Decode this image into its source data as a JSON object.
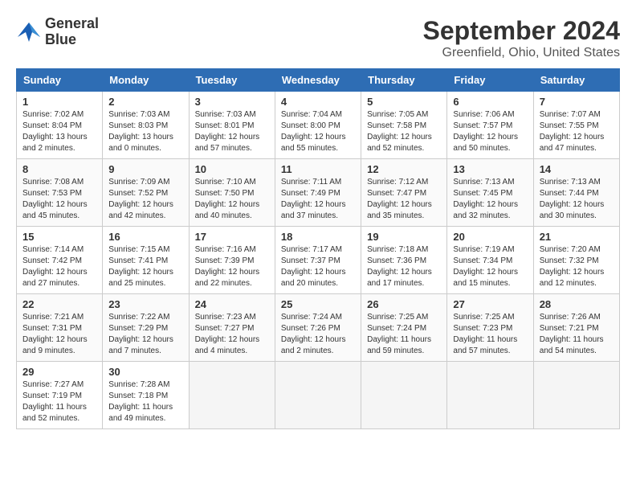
{
  "logo": {
    "line1": "General",
    "line2": "Blue"
  },
  "title": "September 2024",
  "subtitle": "Greenfield, Ohio, United States",
  "weekdays": [
    "Sunday",
    "Monday",
    "Tuesday",
    "Wednesday",
    "Thursday",
    "Friday",
    "Saturday"
  ],
  "weeks": [
    [
      {
        "day": "1",
        "sunrise": "7:02 AM",
        "sunset": "8:04 PM",
        "daylight": "13 hours and 2 minutes."
      },
      {
        "day": "2",
        "sunrise": "7:03 AM",
        "sunset": "8:03 PM",
        "daylight": "13 hours and 0 minutes."
      },
      {
        "day": "3",
        "sunrise": "7:03 AM",
        "sunset": "8:01 PM",
        "daylight": "12 hours and 57 minutes."
      },
      {
        "day": "4",
        "sunrise": "7:04 AM",
        "sunset": "8:00 PM",
        "daylight": "12 hours and 55 minutes."
      },
      {
        "day": "5",
        "sunrise": "7:05 AM",
        "sunset": "7:58 PM",
        "daylight": "12 hours and 52 minutes."
      },
      {
        "day": "6",
        "sunrise": "7:06 AM",
        "sunset": "7:57 PM",
        "daylight": "12 hours and 50 minutes."
      },
      {
        "day": "7",
        "sunrise": "7:07 AM",
        "sunset": "7:55 PM",
        "daylight": "12 hours and 47 minutes."
      }
    ],
    [
      {
        "day": "8",
        "sunrise": "7:08 AM",
        "sunset": "7:53 PM",
        "daylight": "12 hours and 45 minutes."
      },
      {
        "day": "9",
        "sunrise": "7:09 AM",
        "sunset": "7:52 PM",
        "daylight": "12 hours and 42 minutes."
      },
      {
        "day": "10",
        "sunrise": "7:10 AM",
        "sunset": "7:50 PM",
        "daylight": "12 hours and 40 minutes."
      },
      {
        "day": "11",
        "sunrise": "7:11 AM",
        "sunset": "7:49 PM",
        "daylight": "12 hours and 37 minutes."
      },
      {
        "day": "12",
        "sunrise": "7:12 AM",
        "sunset": "7:47 PM",
        "daylight": "12 hours and 35 minutes."
      },
      {
        "day": "13",
        "sunrise": "7:13 AM",
        "sunset": "7:45 PM",
        "daylight": "12 hours and 32 minutes."
      },
      {
        "day": "14",
        "sunrise": "7:13 AM",
        "sunset": "7:44 PM",
        "daylight": "12 hours and 30 minutes."
      }
    ],
    [
      {
        "day": "15",
        "sunrise": "7:14 AM",
        "sunset": "7:42 PM",
        "daylight": "12 hours and 27 minutes."
      },
      {
        "day": "16",
        "sunrise": "7:15 AM",
        "sunset": "7:41 PM",
        "daylight": "12 hours and 25 minutes."
      },
      {
        "day": "17",
        "sunrise": "7:16 AM",
        "sunset": "7:39 PM",
        "daylight": "12 hours and 22 minutes."
      },
      {
        "day": "18",
        "sunrise": "7:17 AM",
        "sunset": "7:37 PM",
        "daylight": "12 hours and 20 minutes."
      },
      {
        "day": "19",
        "sunrise": "7:18 AM",
        "sunset": "7:36 PM",
        "daylight": "12 hours and 17 minutes."
      },
      {
        "day": "20",
        "sunrise": "7:19 AM",
        "sunset": "7:34 PM",
        "daylight": "12 hours and 15 minutes."
      },
      {
        "day": "21",
        "sunrise": "7:20 AM",
        "sunset": "7:32 PM",
        "daylight": "12 hours and 12 minutes."
      }
    ],
    [
      {
        "day": "22",
        "sunrise": "7:21 AM",
        "sunset": "7:31 PM",
        "daylight": "12 hours and 9 minutes."
      },
      {
        "day": "23",
        "sunrise": "7:22 AM",
        "sunset": "7:29 PM",
        "daylight": "12 hours and 7 minutes."
      },
      {
        "day": "24",
        "sunrise": "7:23 AM",
        "sunset": "7:27 PM",
        "daylight": "12 hours and 4 minutes."
      },
      {
        "day": "25",
        "sunrise": "7:24 AM",
        "sunset": "7:26 PM",
        "daylight": "12 hours and 2 minutes."
      },
      {
        "day": "26",
        "sunrise": "7:25 AM",
        "sunset": "7:24 PM",
        "daylight": "11 hours and 59 minutes."
      },
      {
        "day": "27",
        "sunrise": "7:25 AM",
        "sunset": "7:23 PM",
        "daylight": "11 hours and 57 minutes."
      },
      {
        "day": "28",
        "sunrise": "7:26 AM",
        "sunset": "7:21 PM",
        "daylight": "11 hours and 54 minutes."
      }
    ],
    [
      {
        "day": "29",
        "sunrise": "7:27 AM",
        "sunset": "7:19 PM",
        "daylight": "11 hours and 52 minutes."
      },
      {
        "day": "30",
        "sunrise": "7:28 AM",
        "sunset": "7:18 PM",
        "daylight": "11 hours and 49 minutes."
      },
      null,
      null,
      null,
      null,
      null
    ]
  ]
}
